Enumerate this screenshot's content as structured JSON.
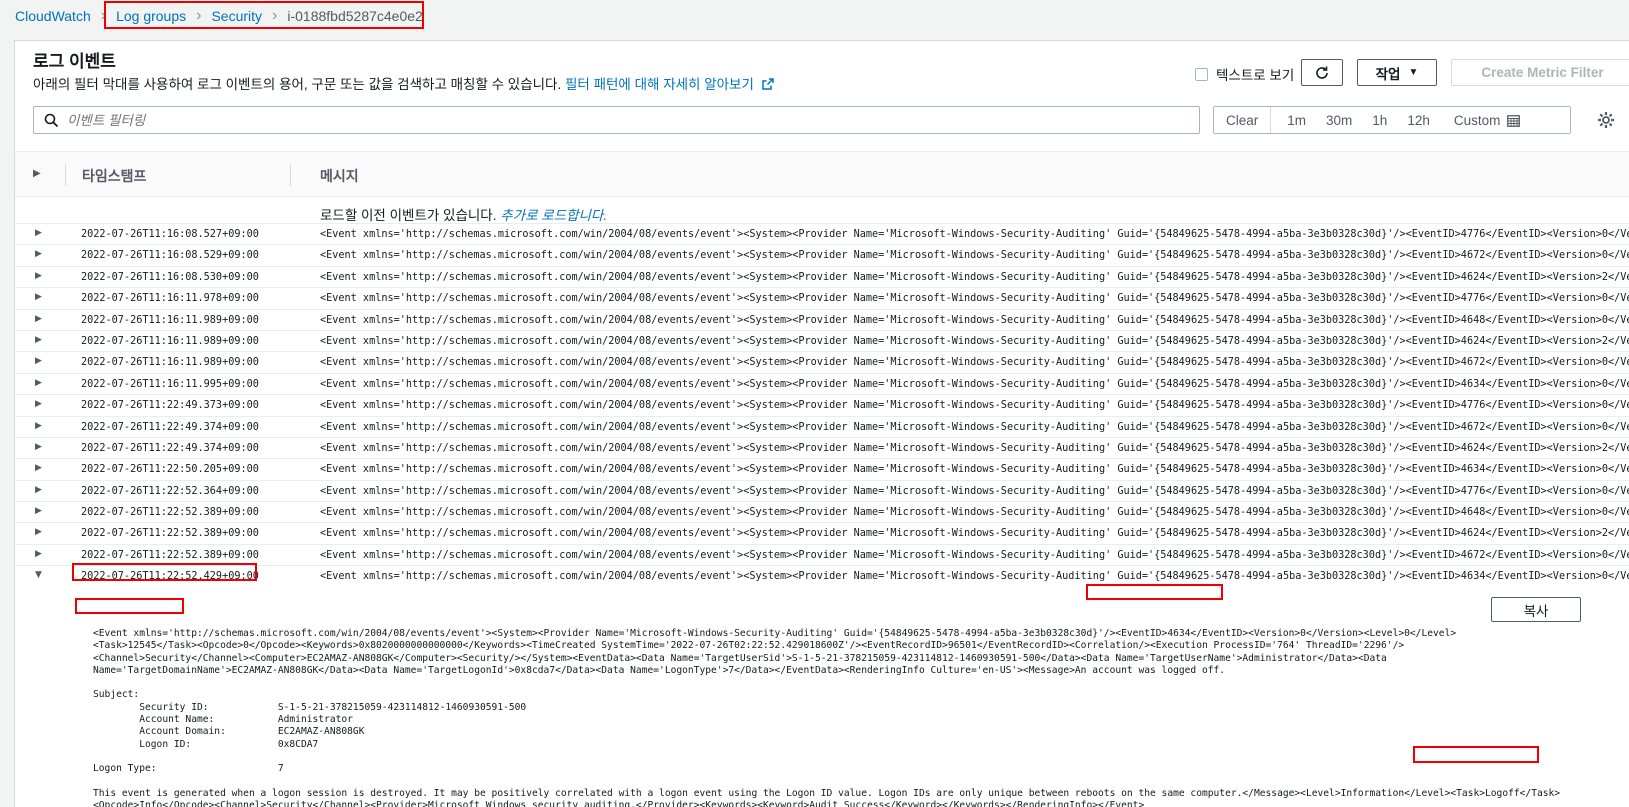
{
  "breadcrumb": {
    "root": "CloudWatch",
    "items": [
      "Log groups",
      "Security",
      "i-0188fbd5287c4e0e2"
    ]
  },
  "header": {
    "title": "로그 이벤트",
    "description": "아래의 필터 막대를 사용하여 로그 이벤트의 용어, 구문 또는 값을 검색하고 매칭할 수 있습니다.",
    "learn_more_link": "필터 패턴에 대해 자세히 알아보기"
  },
  "toolbar": {
    "text_view_label": "텍스트로 보기",
    "action_label": "작업",
    "create_metric_filter_label": "Create Metric Filter"
  },
  "search": {
    "placeholder": "이벤트 필터링"
  },
  "time_range": {
    "clear": "Clear",
    "options": [
      "1m",
      "30m",
      "1h",
      "12h"
    ],
    "custom": "Custom"
  },
  "table": {
    "columns": {
      "timestamp": "타임스탬프",
      "message": "메시지"
    },
    "load_more_text": "로드할 이전 이벤트가 있습니다.",
    "load_more_link": "추가로 로드합니다.",
    "rows": [
      {
        "ts": "2022-07-26T11:16:08.527+09:00",
        "msg": "<Event xmlns='http://schemas.microsoft.com/win/2004/08/events/event'><System><Provider Name='Microsoft-Windows-Security-Auditing' Guid='{54849625-5478-4994-a5ba-3e3b0328c30d}'/><EventID>4776</EventID><Version>0</Ver…"
      },
      {
        "ts": "2022-07-26T11:16:08.529+09:00",
        "msg": "<Event xmlns='http://schemas.microsoft.com/win/2004/08/events/event'><System><Provider Name='Microsoft-Windows-Security-Auditing' Guid='{54849625-5478-4994-a5ba-3e3b0328c30d}'/><EventID>4672</EventID><Version>0</Ver…"
      },
      {
        "ts": "2022-07-26T11:16:08.530+09:00",
        "msg": "<Event xmlns='http://schemas.microsoft.com/win/2004/08/events/event'><System><Provider Name='Microsoft-Windows-Security-Auditing' Guid='{54849625-5478-4994-a5ba-3e3b0328c30d}'/><EventID>4624</EventID><Version>2</Ver…"
      },
      {
        "ts": "2022-07-26T11:16:11.978+09:00",
        "msg": "<Event xmlns='http://schemas.microsoft.com/win/2004/08/events/event'><System><Provider Name='Microsoft-Windows-Security-Auditing' Guid='{54849625-5478-4994-a5ba-3e3b0328c30d}'/><EventID>4776</EventID><Version>0</Ver…"
      },
      {
        "ts": "2022-07-26T11:16:11.989+09:00",
        "msg": "<Event xmlns='http://schemas.microsoft.com/win/2004/08/events/event'><System><Provider Name='Microsoft-Windows-Security-Auditing' Guid='{54849625-5478-4994-a5ba-3e3b0328c30d}'/><EventID>4648</EventID><Version>0</Ver…"
      },
      {
        "ts": "2022-07-26T11:16:11.989+09:00",
        "msg": "<Event xmlns='http://schemas.microsoft.com/win/2004/08/events/event'><System><Provider Name='Microsoft-Windows-Security-Auditing' Guid='{54849625-5478-4994-a5ba-3e3b0328c30d}'/><EventID>4624</EventID><Version>2</Ver…"
      },
      {
        "ts": "2022-07-26T11:16:11.989+09:00",
        "msg": "<Event xmlns='http://schemas.microsoft.com/win/2004/08/events/event'><System><Provider Name='Microsoft-Windows-Security-Auditing' Guid='{54849625-5478-4994-a5ba-3e3b0328c30d}'/><EventID>4672</EventID><Version>0</Ver…"
      },
      {
        "ts": "2022-07-26T11:16:11.995+09:00",
        "msg": "<Event xmlns='http://schemas.microsoft.com/win/2004/08/events/event'><System><Provider Name='Microsoft-Windows-Security-Auditing' Guid='{54849625-5478-4994-a5ba-3e3b0328c30d}'/><EventID>4634</EventID><Version>0</Ver…"
      },
      {
        "ts": "2022-07-26T11:22:49.373+09:00",
        "msg": "<Event xmlns='http://schemas.microsoft.com/win/2004/08/events/event'><System><Provider Name='Microsoft-Windows-Security-Auditing' Guid='{54849625-5478-4994-a5ba-3e3b0328c30d}'/><EventID>4776</EventID><Version>0</Ver…"
      },
      {
        "ts": "2022-07-26T11:22:49.374+09:00",
        "msg": "<Event xmlns='http://schemas.microsoft.com/win/2004/08/events/event'><System><Provider Name='Microsoft-Windows-Security-Auditing' Guid='{54849625-5478-4994-a5ba-3e3b0328c30d}'/><EventID>4672</EventID><Version>0</Ver…"
      },
      {
        "ts": "2022-07-26T11:22:49.374+09:00",
        "msg": "<Event xmlns='http://schemas.microsoft.com/win/2004/08/events/event'><System><Provider Name='Microsoft-Windows-Security-Auditing' Guid='{54849625-5478-4994-a5ba-3e3b0328c30d}'/><EventID>4624</EventID><Version>2</Ver…"
      },
      {
        "ts": "2022-07-26T11:22:50.205+09:00",
        "msg": "<Event xmlns='http://schemas.microsoft.com/win/2004/08/events/event'><System><Provider Name='Microsoft-Windows-Security-Auditing' Guid='{54849625-5478-4994-a5ba-3e3b0328c30d}'/><EventID>4634</EventID><Version>0</Ver…"
      },
      {
        "ts": "2022-07-26T11:22:52.364+09:00",
        "msg": "<Event xmlns='http://schemas.microsoft.com/win/2004/08/events/event'><System><Provider Name='Microsoft-Windows-Security-Auditing' Guid='{54849625-5478-4994-a5ba-3e3b0328c30d}'/><EventID>4776</EventID><Version>0</Ver…"
      },
      {
        "ts": "2022-07-26T11:22:52.389+09:00",
        "msg": "<Event xmlns='http://schemas.microsoft.com/win/2004/08/events/event'><System><Provider Name='Microsoft-Windows-Security-Auditing' Guid='{54849625-5478-4994-a5ba-3e3b0328c30d}'/><EventID>4648</EventID><Version>0</Ver…"
      },
      {
        "ts": "2022-07-26T11:22:52.389+09:00",
        "msg": "<Event xmlns='http://schemas.microsoft.com/win/2004/08/events/event'><System><Provider Name='Microsoft-Windows-Security-Auditing' Guid='{54849625-5478-4994-a5ba-3e3b0328c30d}'/><EventID>4624</EventID><Version>2</Ver…"
      },
      {
        "ts": "2022-07-26T11:22:52.389+09:00",
        "msg": "<Event xmlns='http://schemas.microsoft.com/win/2004/08/events/event'><System><Provider Name='Microsoft-Windows-Security-Auditing' Guid='{54849625-5478-4994-a5ba-3e3b0328c30d}'/><EventID>4672</EventID><Version>0</Ver…"
      },
      {
        "ts": "2022-07-26T11:22:52.429+09:00",
        "msg": "<Event xmlns='http://schemas.microsoft.com/win/2004/08/events/event'><System><Provider Name='Microsoft-Windows-Security-Auditing' Guid='{54849625-5478-4994-a5ba-3e3b0328c30d}'/><EventID>4634</EventID><Version>0</Ver…",
        "expanded": true
      }
    ]
  },
  "expanded_event": {
    "copy_label": "복사",
    "text": "<Event xmlns='http://schemas.microsoft.com/win/2004/08/events/event'><System><Provider Name='Microsoft-Windows-Security-Auditing' Guid='{54849625-5478-4994-a5ba-3e3b0328c30d}'/><EventID>4634</EventID><Version>0</Version><Level>0</Level>\n<Task>12545</Task><Opcode>0</Opcode><Keywords>0x8020000000000000</Keywords><TimeCreated SystemTime='2022-07-26T02:22:52.429018600Z'/><EventRecordID>96501</EventRecordID><Correlation/><Execution ProcessID='764' ThreadID='2296'/>\n<Channel>Security</Channel><Computer>EC2AMAZ-AN808GK</Computer><Security/></System><EventData><Data Name='TargetUserSid'>S-1-5-21-378215059-423114812-1460930591-500</Data><Data Name='TargetUserName'>Administrator</Data><Data\nName='TargetDomainName'>EC2AMAZ-AN808GK</Data><Data Name='TargetLogonId'>0x8cda7</Data><Data Name='LogonType'>7</Data></EventData><RenderingInfo Culture='en-US'><Message>An account was logged off.\n\nSubject:\n\tSecurity ID:\t\tS-1-5-21-378215059-423114812-1460930591-500\n\tAccount Name:\t\tAdministrator\n\tAccount Domain:\t\tEC2AMAZ-AN808GK\n\tLogon ID:\t\t0x8CDA7\n\nLogon Type:\t\t\t7\n\nThis event is generated when a logon session is destroyed. It may be positively correlated with a logon event using the Logon ID value. Logon IDs are only unique between reboots on the same computer.</Message><Level>Information</Level><Task>Logoff</Task>\n<Opcode>Info</Opcode><Channel>Security</Channel><Provider>Microsoft Windows security auditing.</Provider><Keywords><Keyword>Audit Success</Keyword></Keywords></RenderingInfo></Event>"
  },
  "icons": {
    "breadcrumb_separator": "chevron-right-icon",
    "refresh": "refresh-icon",
    "search": "search-icon",
    "calendar": "calendar-icon",
    "settings": "gear-icon",
    "external_link": "external-link-icon"
  },
  "colors": {
    "link": "#0073bb",
    "highlight": "#ee0000",
    "text": "#16191f"
  }
}
